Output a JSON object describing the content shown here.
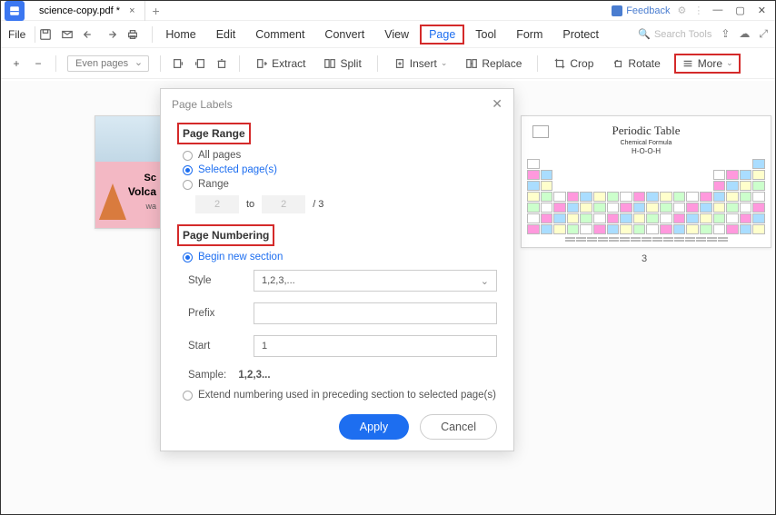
{
  "titlebar": {
    "tab_name": "science-copy.pdf *",
    "feedback": "Feedback"
  },
  "menubar": {
    "file": "File",
    "items": [
      "Home",
      "Edit",
      "Comment",
      "Convert",
      "View",
      "Page",
      "Tool",
      "Form",
      "Protect"
    ],
    "active": "Page",
    "search_placeholder": "Search Tools"
  },
  "toolbar": {
    "even_pages": "Even pages",
    "extract": "Extract",
    "split": "Split",
    "insert": "Insert",
    "replace": "Replace",
    "crop": "Crop",
    "rotate": "Rotate",
    "more": "More"
  },
  "thumb1": {
    "line1": "Sc",
    "line2": "Volca",
    "line3": "wa"
  },
  "thumb3": {
    "title": "Periodic Table",
    "sub": "Chemical Formula",
    "formula": "H-O-O-H",
    "page_num": "3"
  },
  "dialog": {
    "title": "Page Labels",
    "section_range": "Page Range",
    "opt_all": "All pages",
    "opt_selected": "Selected page(s)",
    "opt_range": "Range",
    "range_from": "2",
    "range_to_label": "to",
    "range_to": "2",
    "range_total": "/ 3",
    "section_numbering": "Page Numbering",
    "opt_begin": "Begin new section",
    "style_label": "Style",
    "style_value": "1,2,3,...",
    "prefix_label": "Prefix",
    "prefix_value": "",
    "start_label": "Start",
    "start_value": "1",
    "sample_label": "Sample:",
    "sample_value": "1,2,3...",
    "opt_extend": "Extend numbering used in preceding section to selected page(s)",
    "apply": "Apply",
    "cancel": "Cancel"
  }
}
